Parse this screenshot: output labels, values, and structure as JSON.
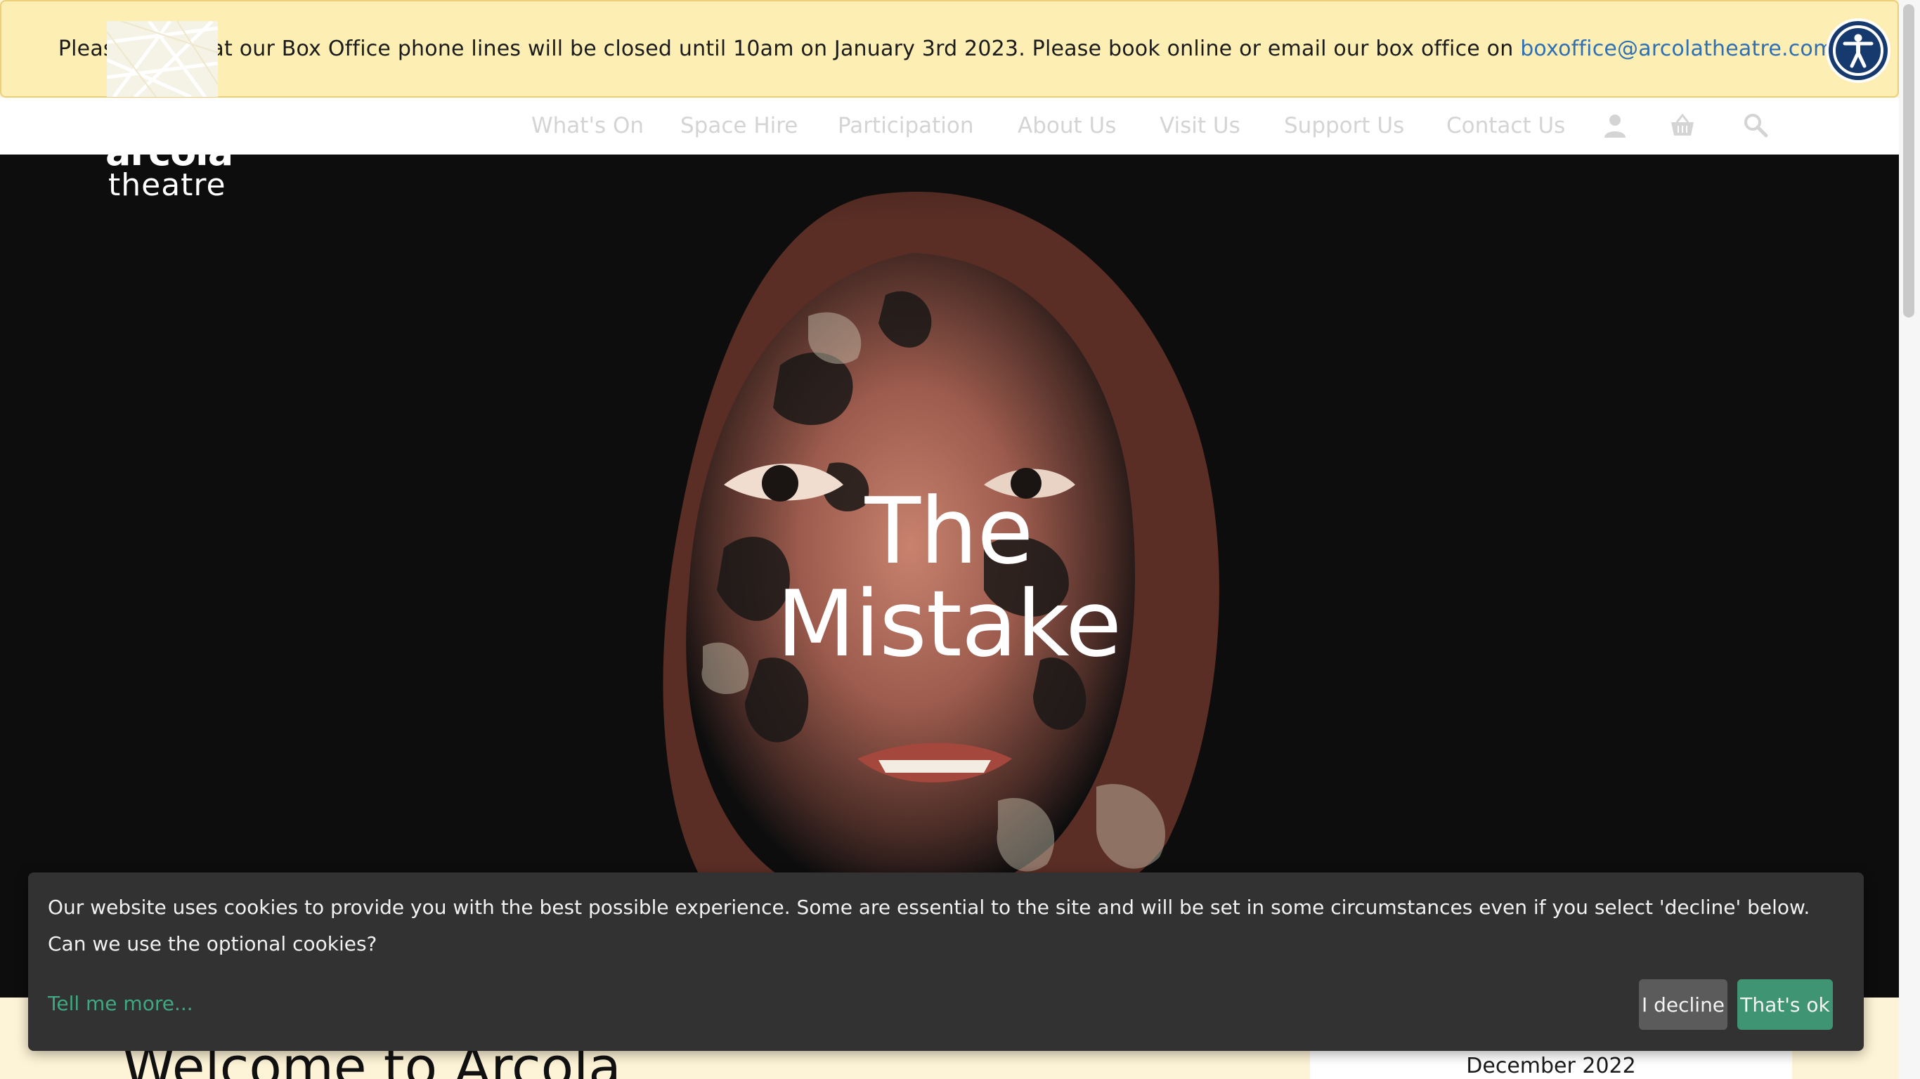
{
  "notice": {
    "text": "Please note that our Box Office phone lines will be closed until 10am on January 3rd 2023. Please book online or email our box office on ",
    "email": "boxoffice@arcolatheatre.com",
    "suffix": "."
  },
  "accessibility": {
    "icon": "accessibility-icon"
  },
  "logo": {
    "line1": "arcola",
    "line2": "theatre"
  },
  "nav": {
    "items": [
      {
        "label": "What's On"
      },
      {
        "label": "Space Hire"
      },
      {
        "label": "Participation"
      },
      {
        "label": "About Us"
      },
      {
        "label": "Visit Us"
      },
      {
        "label": "Support Us"
      },
      {
        "label": "Contact Us"
      }
    ],
    "icons": [
      "account-icon",
      "basket-icon",
      "search-icon"
    ]
  },
  "hero": {
    "title_line1": "The",
    "title_line2": "Mistake"
  },
  "main": {
    "welcome_title": "Welcome to Arcola"
  },
  "sidebar": {
    "month": "December 2022"
  },
  "cookie": {
    "text": "Our website uses cookies to provide you with the best possible experience. Some are essential to the site and will be set in some circumstances even if you select 'decline' below. Can we use the optional cookies?",
    "more_link": "Tell me more...",
    "decline_label": "I decline",
    "accept_label": "That's ok"
  },
  "colors": {
    "notice_bg": "#fdeeb4",
    "link": "#2f6fb3",
    "accept": "#3f9474",
    "cookie_bg": "#323232",
    "accessibility": "#163a6e"
  }
}
